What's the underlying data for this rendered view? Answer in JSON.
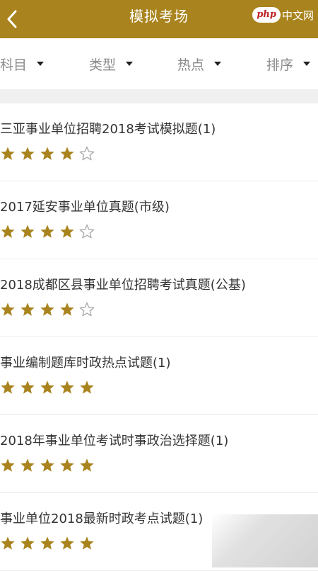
{
  "header": {
    "title": "模拟考场",
    "watermark_logo": "php",
    "watermark_text": "中文网"
  },
  "filters": [
    {
      "label": "科目"
    },
    {
      "label": "类型"
    },
    {
      "label": "热点"
    },
    {
      "label": "排序"
    }
  ],
  "items": [
    {
      "title": "三亚事业单位招聘2018考试模拟题(1)",
      "rating": 4
    },
    {
      "title": "2017延安事业单位真题(市级)",
      "rating": 4
    },
    {
      "title": "2018成都区县事业单位招聘考试真题(公基)",
      "rating": 4
    },
    {
      "title": "事业编制题库时政热点试题(1)",
      "rating": 5
    },
    {
      "title": "2018年事业单位考试时事政治选择题(1)",
      "rating": 5
    },
    {
      "title": "事业单位2018最新时政考点试题(1)",
      "rating": 5
    }
  ],
  "colors": {
    "brand": "#a9841e",
    "star": "#a9841e",
    "star_empty_stroke": "#aaaaaa"
  },
  "icons": {
    "back": "chevron-left-icon",
    "dropdown": "caret-down-icon",
    "star_filled": "star-filled-icon",
    "star_empty": "star-outline-icon"
  }
}
